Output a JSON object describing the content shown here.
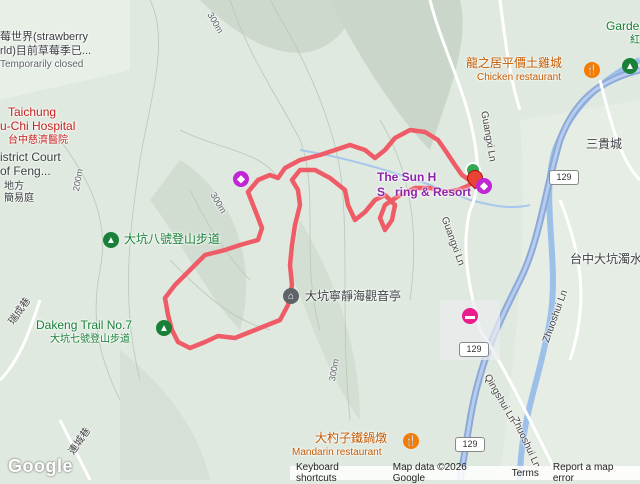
{
  "colors": {
    "terrain": "#dfe9df",
    "track": "#ef5b66",
    "river": "#9cc0e8",
    "highway": "#8da9d6",
    "road": "#ffffff"
  },
  "labels": {
    "strawberry_1": "莓世界(strawberry",
    "strawberry_2": "rld)目前草莓季已...",
    "strawberry_3": "Temporarily closed",
    "hospital_1": "Taichung",
    "hospital_2": "u-Chi Hospital",
    "hospital_3": "台中慈濟醫院",
    "court_1": "istrict Court",
    "court_2": "of Feng...",
    "court_3": "地方",
    "court_4": "簡易庭",
    "restaurant_chicken_1": "龍之居平價土雞城",
    "restaurant_chicken_2": "Chicken restaurant",
    "garden_1": "Garde",
    "garden_2": "紅",
    "sun_hotel_1": "The Sun H",
    "sun_hotel_2": "S",
    "sun_hotel_3": "ring & Resort",
    "trail8": "大坑八號登山步道",
    "temple": "大坑寧靜海觀音亭",
    "trail7_1": "Dakeng Trail No.7",
    "trail7_2": "大坑七號登山步道",
    "sanguancheng": "三貴城",
    "taichung_dakeng": "台中大坑濁水",
    "mandarin_1": "大杓子鐵鍋燉",
    "mandarin_2": "Mandarin restaurant",
    "road_guangxi_1": "Guangxi Ln",
    "road_guangxi_2": "Guangxi Ln",
    "road_zhuoshui_1": "Zhuoshui Ln",
    "road_zhuoshui_2": "Zhuoshui Ln",
    "road_qingshui": "Qingshui Ln",
    "road_side": "瑞成巷",
    "road_side2": "連城巷",
    "contour_300_a": "300m",
    "contour_300_b": "300m",
    "contour_300_c": "300m",
    "contour_200": "200m",
    "route_129_a": "129",
    "route_129_b": "129",
    "route_129_c": "129"
  },
  "footer": {
    "logo": "Google",
    "keyboard": "Keyboard shortcuts",
    "mapdata": "Map data ©2026 Google",
    "terms": "Terms",
    "report": "Report a map error"
  }
}
